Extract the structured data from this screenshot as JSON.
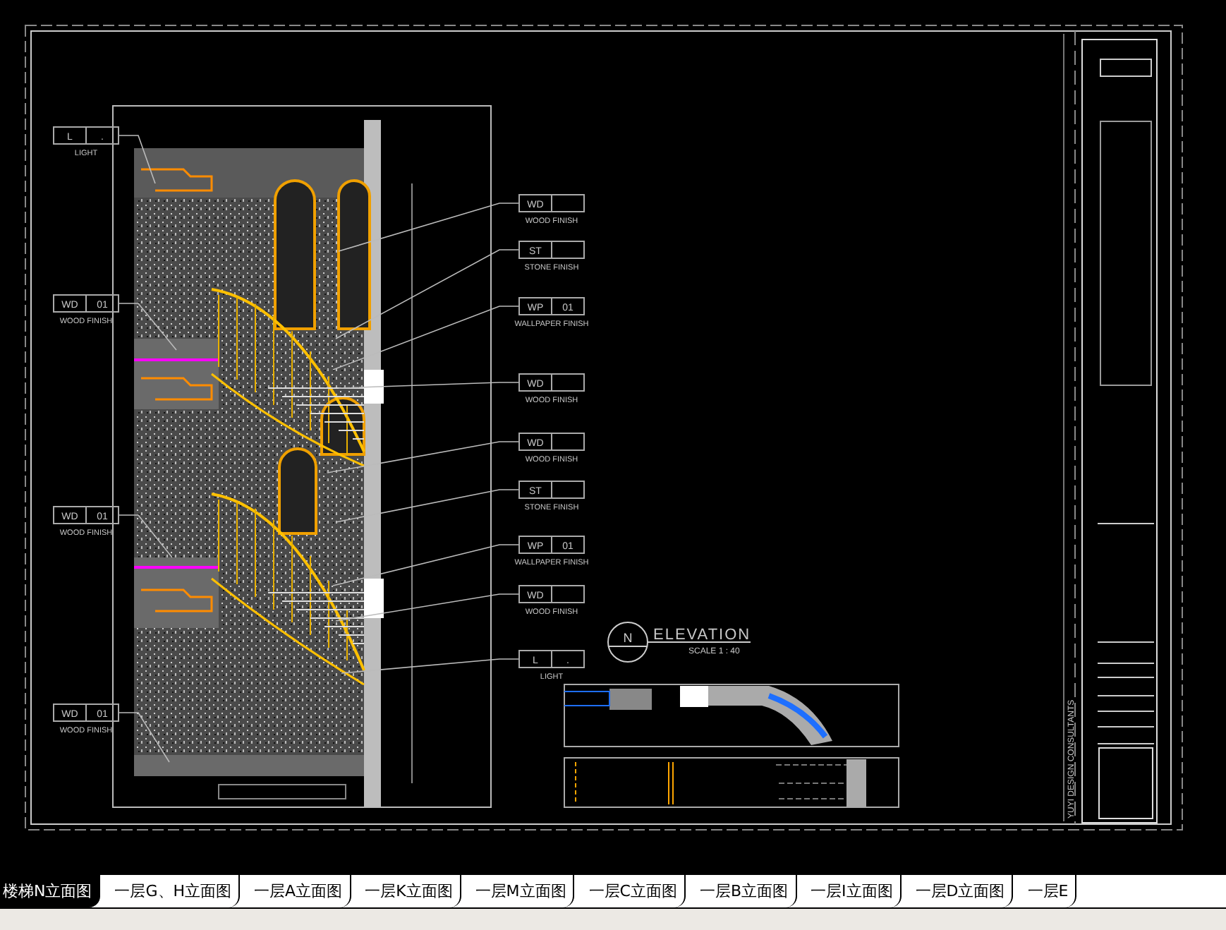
{
  "drawing": {
    "left_tags": [
      {
        "code": "L",
        "number": ".",
        "label": "LIGHT"
      },
      {
        "code": "WD",
        "number": "01",
        "label": "WOOD FINISH"
      },
      {
        "code": "WD",
        "number": "01",
        "label": "WOOD FINISH"
      },
      {
        "code": "WD",
        "number": "01",
        "label": "WOOD FINISH"
      }
    ],
    "right_tags": [
      {
        "code": "WD",
        "label": "WOOD FINISH"
      },
      {
        "code": "ST",
        "label": "STONE FINISH"
      },
      {
        "code": "WP",
        "number": "01",
        "label": "WALLPAPER FINISH"
      },
      {
        "code": "WD",
        "label": "WOOD FINISH"
      },
      {
        "code": "WD",
        "label": "WOOD FINISH"
      },
      {
        "code": "ST",
        "label": "STONE FINISH"
      },
      {
        "code": "WP",
        "number": "01",
        "label": "WALLPAPER FINISH"
      },
      {
        "code": "WD",
        "label": "WOOD FINISH"
      },
      {
        "code": "L",
        "number": ".",
        "label": "LIGHT"
      }
    ],
    "elevation_title": {
      "marker": "N",
      "title": "ELEVATION",
      "scale": "SCALE 1 : 40"
    },
    "side_text": "YUYI DESIGN CONSULTANTS"
  },
  "tabs": [
    {
      "label": "楼梯N立面图",
      "selected": true
    },
    {
      "label": "一层G、H立面图",
      "selected": false
    },
    {
      "label": "一层A立面图",
      "selected": false
    },
    {
      "label": "一层K立面图",
      "selected": false
    },
    {
      "label": "一层M立面图",
      "selected": false
    },
    {
      "label": "一层C立面图",
      "selected": false
    },
    {
      "label": "一层B立面图",
      "selected": false
    },
    {
      "label": "一层I立面图",
      "selected": false
    },
    {
      "label": "一层D立面图",
      "selected": false
    },
    {
      "label": "一层E",
      "selected": false
    }
  ]
}
